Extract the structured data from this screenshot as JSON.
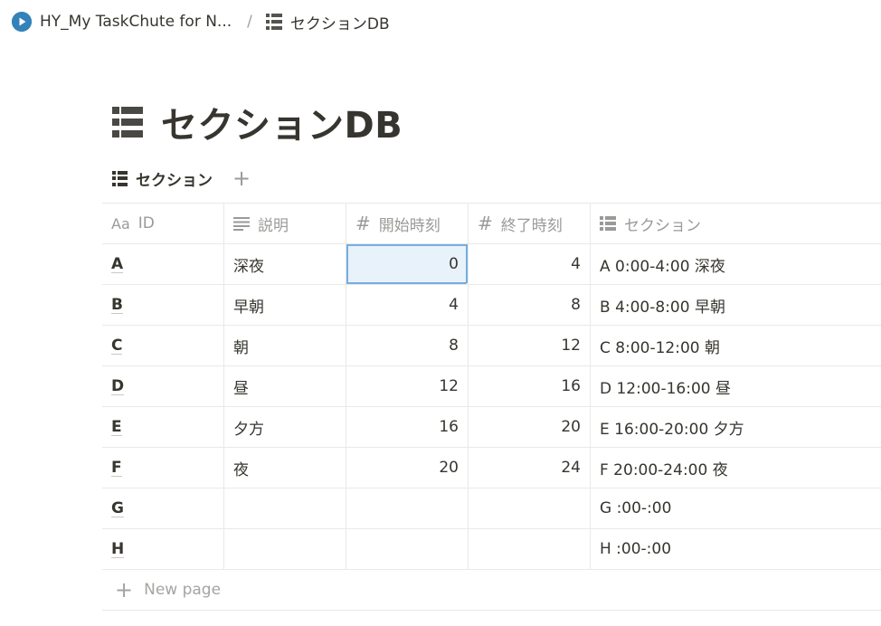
{
  "breadcrumb": {
    "parent": "HY_My TaskChute for N...",
    "separator": "/",
    "current": "セクションDB"
  },
  "title": "セクションDB",
  "views": {
    "active": "セクション",
    "add": "+"
  },
  "table": {
    "columns": {
      "id": {
        "icon": "Aa",
        "label": "ID"
      },
      "desc": {
        "icon": "lines-icon",
        "label": "説明"
      },
      "start": {
        "icon": "#",
        "label": "開始時刻"
      },
      "end": {
        "icon": "#",
        "label": "終了時刻"
      },
      "section": {
        "icon": "db-icon",
        "label": "セクション"
      }
    },
    "rows": [
      {
        "id": "A",
        "desc": "深夜",
        "start": "0",
        "end": "4",
        "section": "A 0:00-4:00 深夜"
      },
      {
        "id": "B",
        "desc": "早朝",
        "start": "4",
        "end": "8",
        "section": "B 4:00-8:00 早朝"
      },
      {
        "id": "C",
        "desc": "朝",
        "start": "8",
        "end": "12",
        "section": "C 8:00-12:00 朝"
      },
      {
        "id": "D",
        "desc": "昼",
        "start": "12",
        "end": "16",
        "section": "D 12:00-16:00 昼"
      },
      {
        "id": "E",
        "desc": "夕方",
        "start": "16",
        "end": "20",
        "section": "E 16:00-20:00 夕方"
      },
      {
        "id": "F",
        "desc": "夜",
        "start": "20",
        "end": "24",
        "section": "F 20:00-24:00 夜"
      },
      {
        "id": "G",
        "desc": "",
        "start": "",
        "end": "",
        "section": "G :00-:00"
      },
      {
        "id": "H",
        "desc": "",
        "start": "",
        "end": "",
        "section": "H :00-:00"
      }
    ],
    "new_page": {
      "icon": "+",
      "label": "New page"
    }
  },
  "colors": {
    "text": "#37352f",
    "muted": "#9b9a97",
    "border": "#e9e9e7",
    "selection_bg": "#e8f2fb",
    "selection_border": "#74aee0",
    "play_icon": "#3382b8"
  }
}
